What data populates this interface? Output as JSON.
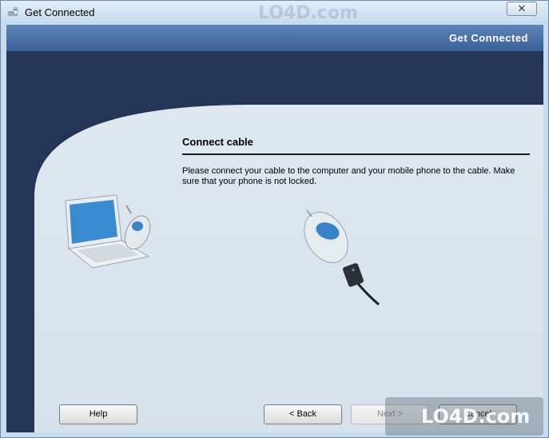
{
  "window": {
    "title": "Get Connected",
    "close_label": "✕"
  },
  "header": {
    "title": "Get Connected"
  },
  "main": {
    "section_title": "Connect cable",
    "description": "Please connect your cable to the computer and your mobile phone to the cable. Make sure that your phone is not locked."
  },
  "buttons": {
    "help": "Help",
    "back": "< Back",
    "next": "Next >",
    "cancel": "Cancel"
  },
  "watermark": {
    "text": "LO4D.com"
  },
  "colors": {
    "dark_navy": "#243556",
    "panel": "#dde6ef",
    "accent_blue": "#3b6099"
  },
  "icons": [
    "app-phone-icon",
    "laptop-phone-illustration",
    "phone-cable-illustration"
  ]
}
